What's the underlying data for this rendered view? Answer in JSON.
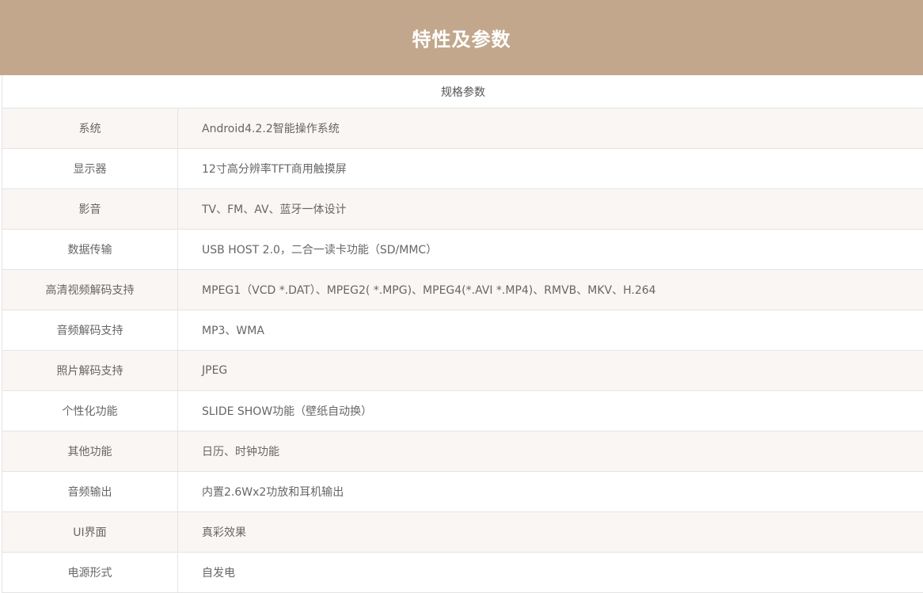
{
  "header": {
    "title": "特性及参数"
  },
  "table": {
    "caption": "规格参数",
    "rows": [
      {
        "label": "系统",
        "value": "Android4.2.2智能操作系统"
      },
      {
        "label": "显示器",
        "value": "12寸高分辨率TFT商用触摸屏"
      },
      {
        "label": "影音",
        "value": "TV、FM、AV、蓝牙一体设计"
      },
      {
        "label": "数据传输",
        "value": "USB HOST 2.0，二合一读卡功能（SD/MMC）"
      },
      {
        "label": "高清视频解码支持",
        "value": "MPEG1（VCD *.DAT）、MPEG2( *.MPG)、MPEG4(*.AVI *.MP4)、RMVB、MKV、H.264"
      },
      {
        "label": "音频解码支持",
        "value": "MP3、WMA"
      },
      {
        "label": "照片解码支持",
        "value": "JPEG"
      },
      {
        "label": "个性化功能",
        "value": "SLIDE SHOW功能（壁纸自动换）"
      },
      {
        "label": "其他功能",
        "value": "日历、时钟功能"
      },
      {
        "label": "音频输出",
        "value": "内置2.6Wx2功放和耳机输出"
      },
      {
        "label": "UI界面",
        "value": "真彩效果"
      },
      {
        "label": "电源形式",
        "value": "自发电"
      }
    ]
  },
  "colors": {
    "header_bg": "#c2a78c",
    "header_text": "#ffffff",
    "row_alt_bg": "#faf6f4",
    "border": "#e4e4e4"
  }
}
